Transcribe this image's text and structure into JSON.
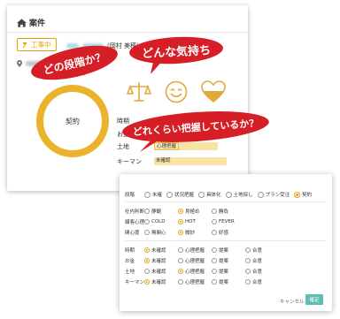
{
  "card": {
    "title": "案件",
    "status_tag": "工事中",
    "owner": "(岡村 美穂)",
    "ring_label": "契約",
    "row_labels": [
      "時期",
      "お金",
      "土地",
      "キーマン"
    ],
    "land_level": "心理把握",
    "keyman_level": "未確認"
  },
  "icons": [
    "scales-icon",
    "smiley-icon",
    "heart-icon"
  ],
  "colors": {
    "accent": "#e9b32b",
    "bubble": "#d61e27",
    "confirm": "#5fbdb2"
  },
  "bubbles": {
    "stage": "どの段階か？",
    "feeling": "どんな気持ち",
    "grasp": "どれくらい把握しているか？"
  },
  "panel": {
    "stage": {
      "label": "段階",
      "options": [
        "未確",
        "状況把握",
        "具体化",
        "土地探し",
        "プラン受注",
        "契約"
      ],
      "selected": "契約"
    },
    "company": {
      "label": "社内判断",
      "options": [
        "静観",
        "見極め",
        "勝負"
      ],
      "selected": "見極め"
    },
    "customer_mind": {
      "label": "顧客心理",
      "options": [
        "COLD",
        "HOT",
        "FEVER"
      ],
      "selected": "HOT"
    },
    "interest": {
      "label": "関心度",
      "options": [
        "無関心",
        "微妙",
        "好感"
      ],
      "selected": "微妙"
    },
    "grid_options": [
      "未確認",
      "心理把握",
      "提案",
      "合意"
    ],
    "grid_rows": [
      {
        "label": "時期",
        "selected": "未確認"
      },
      {
        "label": "お金",
        "selected": "未確認"
      },
      {
        "label": "土地",
        "selected": "心理把握"
      },
      {
        "label": "キーマン",
        "selected": "未確認"
      }
    ],
    "cancel": "キャンセル",
    "ok": "確定"
  }
}
